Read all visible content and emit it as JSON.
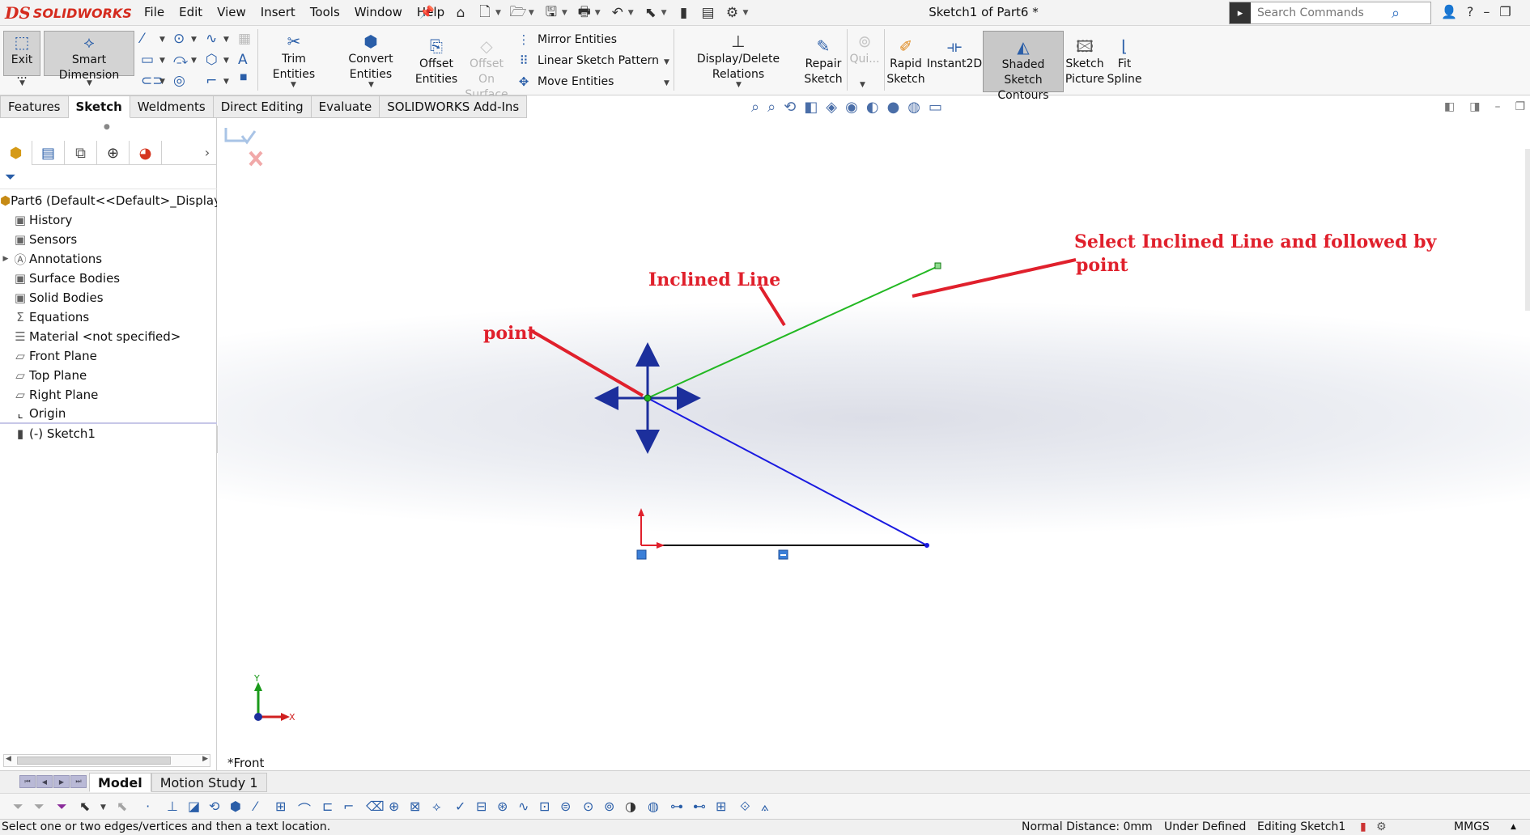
{
  "app": {
    "logo_ds": "DS",
    "logo_name": "SOLIDWORKS",
    "menus": [
      "File",
      "Edit",
      "View",
      "Insert",
      "Tools",
      "Window",
      "Help"
    ],
    "document_title": "Sketch1 of Part6 *",
    "search_placeholder": "Search Commands"
  },
  "commands": {
    "exit_sketch": "Exit ...",
    "smart_dimension": "Smart Dimension",
    "trim_entities": "Trim Entities",
    "convert_entities": "Convert Entities",
    "offset_entities_1": "Offset",
    "offset_entities_2": "Entities",
    "offset_on_surface_1": "Offset On",
    "offset_on_surface_2": "Surface",
    "mirror_entities": "Mirror Entities",
    "linear_sketch_pattern": "Linear Sketch Pattern",
    "move_entities": "Move Entities",
    "display_delete_relations": "Display/Delete Relations",
    "repair_sketch_1": "Repair",
    "repair_sketch_2": "Sketch",
    "quick_snaps": "Qui...",
    "rapid_sketch_1": "Rapid",
    "rapid_sketch_2": "Sketch",
    "instant2d": "Instant2D",
    "shaded_contours_1": "Shaded Sketch",
    "shaded_contours_2": "Contours",
    "sketch_picture_1": "Sketch",
    "sketch_picture_2": "Picture",
    "fit_spline_1": "Fit",
    "fit_spline_2": "Spline"
  },
  "tabs": [
    "Features",
    "Sketch",
    "Weldments",
    "Direct Editing",
    "Evaluate",
    "SOLIDWORKS Add-Ins"
  ],
  "tree": {
    "root": "Part6  (Default<<Default>_Display S",
    "items": [
      "History",
      "Sensors",
      "Annotations",
      "Surface Bodies",
      "Solid Bodies",
      "Equations",
      "Material <not specified>",
      "Front Plane",
      "Top Plane",
      "Right Plane",
      "Origin",
      "(-) Sketch1"
    ]
  },
  "graphics": {
    "annotation_point": "point",
    "annotation_inclined": "Inclined Line",
    "annotation_select_1": "Select Inclined Line and followed by",
    "annotation_select_2": "point",
    "view_label": "*Front",
    "triad_x": "X",
    "triad_y": "Y",
    "colors": {
      "inclined_line": "#22b822",
      "second_line": "#1a1ae0",
      "base_line": "#000000",
      "annotation": "#e0202c",
      "move_arrows": "#1c2f9c"
    }
  },
  "bottom_tabs": [
    "Model",
    "Motion Study 1"
  ],
  "status": {
    "message": "Select one or two edges/vertices and then a text location.",
    "normal_distance": "Normal Distance: 0mm",
    "definition": "Under Defined",
    "editing": "Editing Sketch1",
    "units": "MMGS"
  }
}
